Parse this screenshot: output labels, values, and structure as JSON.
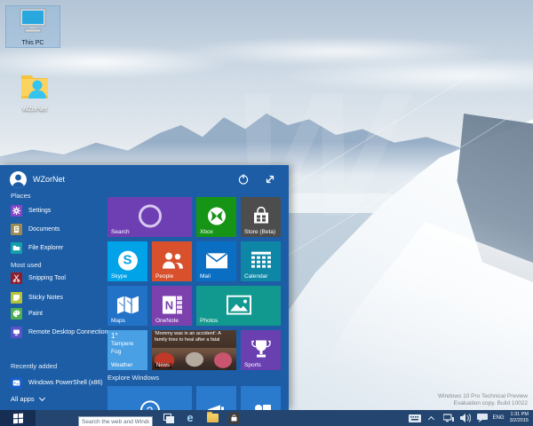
{
  "desktop": {
    "icon_this_pc": "This PC",
    "icon_user_folder": "WZorNet",
    "watermark_line1": "Windows 10 Pro Technical Preview",
    "watermark_line2": "Evaluation copy. Build 10022"
  },
  "start_menu": {
    "user_name": "WZorNet",
    "section_places": "Places",
    "places_items": [
      "Settings",
      "Documents",
      "File Explorer"
    ],
    "section_most_used": "Most used",
    "most_used_items": [
      "Snipping Tool",
      "Sticky Notes",
      "Paint",
      "Remote Desktop Connection"
    ],
    "section_recently_added": "Recently added",
    "recently_added_items": [
      "Windows PowerShell (x86)"
    ],
    "all_apps_label": "All apps",
    "section_explore": "Explore Windows",
    "tiles": {
      "search": "Search",
      "xbox": "Xbox",
      "store": "Store (Beta)",
      "skype": "Skype",
      "people": "People",
      "mail": "Mail",
      "calendar": "Calendar",
      "maps": "Maps",
      "onenote": "OneNote",
      "onenote_letter": "N",
      "photos": "Photos",
      "weather": {
        "temp": "1°",
        "city": "Tampere",
        "condition": "Fog",
        "label": "Weather"
      },
      "news": {
        "headline": "'Mommy was in an accident': A family tries to heal after a fatal",
        "label": "News"
      },
      "sports": "Sports",
      "get_started_glyph": "?"
    }
  },
  "taskbar": {
    "search_placeholder": "Search the web and Windows",
    "tray_language": "ENG",
    "tray_time": "1:31 PM",
    "tray_date": "3/2/2015"
  },
  "colors": {
    "menu_background": "#1c5da6",
    "taskbar": "#24456f",
    "tile_search": "#6e3fb3",
    "tile_xbox": "#169416",
    "tile_store": "#4d4d4d",
    "tile_skype": "#00a2e8",
    "tile_people": "#d9512c",
    "tile_mail": "#0a6fc2",
    "tile_calendar": "#0e87a7",
    "tile_maps": "#2272c8",
    "tile_onenote": "#7c41ad",
    "tile_photos": "#12998f",
    "tile_weather": "#4aa0e4",
    "tile_sports": "#6a3fb0",
    "tile_explore_blue": "#2a7ace"
  }
}
